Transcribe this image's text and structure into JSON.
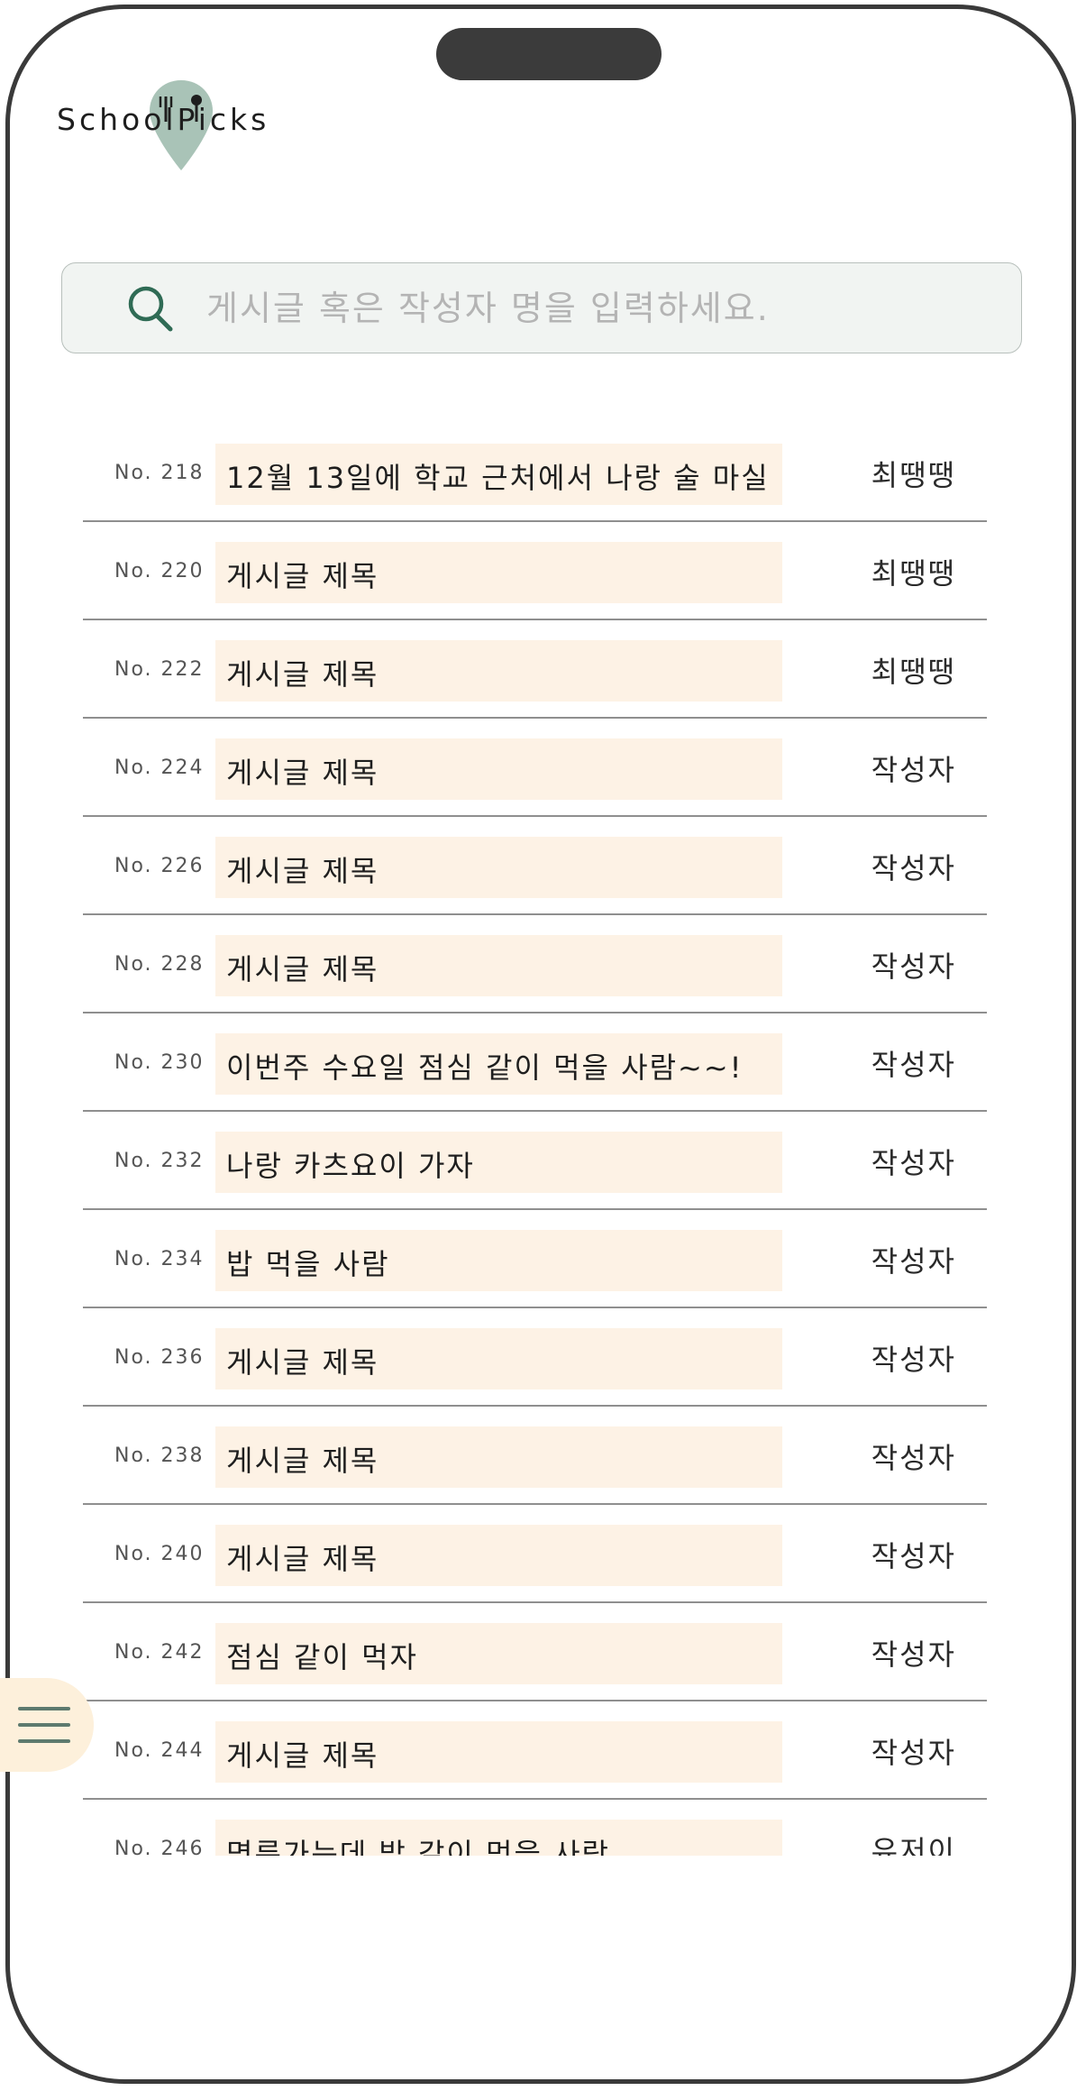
{
  "app": {
    "logo_text": "SchoolPicks"
  },
  "search": {
    "placeholder": "게시글 혹은 작성자 명을 입력하세요."
  },
  "posts": [
    {
      "number": "No. 218",
      "title": "12월 13일에 학교 근처에서 나랑 술 마실",
      "author": "최땡땡"
    },
    {
      "number": "No. 220",
      "title": "게시글 제목",
      "author": "최땡땡"
    },
    {
      "number": "No. 222",
      "title": "게시글 제목",
      "author": "최땡땡"
    },
    {
      "number": "No. 224",
      "title": "게시글 제목",
      "author": "작성자"
    },
    {
      "number": "No. 226",
      "title": "게시글 제목",
      "author": "작성자"
    },
    {
      "number": "No. 228",
      "title": "게시글 제목",
      "author": "작성자"
    },
    {
      "number": "No. 230",
      "title": "이번주 수요일 점심 같이 먹을 사람~~!",
      "author": "작성자"
    },
    {
      "number": "No. 232",
      "title": "나랑 카츠요이 가자",
      "author": "작성자"
    },
    {
      "number": "No. 234",
      "title": "밥 먹을 사람",
      "author": "작성자"
    },
    {
      "number": "No. 236",
      "title": "게시글 제목",
      "author": "작성자"
    },
    {
      "number": "No. 238",
      "title": "게시글 제목",
      "author": "작성자"
    },
    {
      "number": "No. 240",
      "title": "게시글 제목",
      "author": "작성자"
    },
    {
      "number": "No. 242",
      "title": "점심 같이 먹자",
      "author": "작성자"
    },
    {
      "number": "No. 244",
      "title": "게시글 제목",
      "author": "작성자"
    },
    {
      "number": "No. 246",
      "title": "명륜가는데 밥 같이 먹을 사람",
      "author": "유저이"
    }
  ],
  "colors": {
    "accent": "#2f6b55",
    "pin": "#a9c3b7",
    "title_highlight": "#fdf2e5",
    "fab_background": "#fdf0db"
  },
  "icons": {
    "search": "search-icon",
    "menu": "hamburger-menu-icon",
    "logo_pin": "map-pin-fork-icon"
  }
}
